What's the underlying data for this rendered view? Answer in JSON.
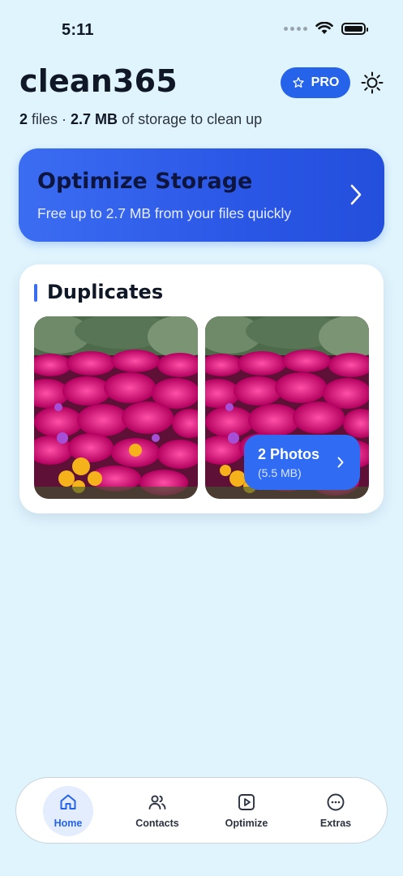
{
  "status_bar": {
    "time": "5:11"
  },
  "header": {
    "app_title": "clean365",
    "pro_label": "PRO",
    "storage_files_count": "2",
    "storage_files_word": " files · ",
    "storage_size": "2.7 MB",
    "storage_suffix": " of storage to clean up"
  },
  "optimize_card": {
    "title": "Optimize Storage",
    "subtitle": "Free up to 2.7 MB from your files quickly"
  },
  "duplicates": {
    "title": "Duplicates",
    "chip_count": "2 Photos",
    "chip_size": "(5.5 MB)"
  },
  "bottom_nav": {
    "items": [
      {
        "label": "Home",
        "icon": "home-icon",
        "active": true
      },
      {
        "label": "Contacts",
        "icon": "contacts-icon",
        "active": false
      },
      {
        "label": "Optimize",
        "icon": "play-square-icon",
        "active": false
      },
      {
        "label": "Extras",
        "icon": "more-circle-icon",
        "active": false
      }
    ]
  },
  "colors": {
    "background": "#dff4fd",
    "accent": "#2563eb",
    "text": "#101726"
  }
}
